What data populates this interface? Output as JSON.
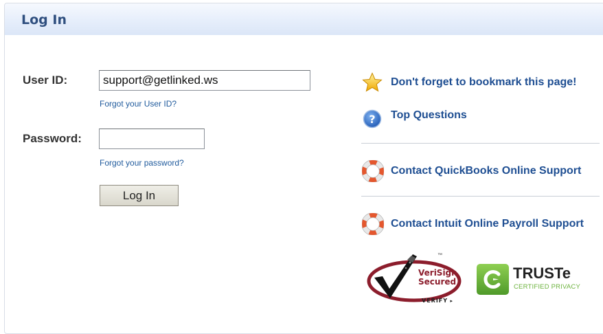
{
  "header": {
    "title": "Log In"
  },
  "form": {
    "user_id_label": "User ID:",
    "user_id_value": "support@getlinked.ws",
    "forgot_user_id": "Forgot your User ID?",
    "password_label": "Password:",
    "password_value": "",
    "forgot_password": "Forgot your password?",
    "login_button": "Log In"
  },
  "sidebar": {
    "bookmark": {
      "label": "Don't forget to bookmark this page!",
      "icon": "star-icon"
    },
    "top_questions": {
      "label": "Top Questions",
      "icon": "question-icon"
    },
    "qbo_support": {
      "label": "Contact QuickBooks Online Support",
      "icon": "lifebuoy-icon"
    },
    "payroll_support": {
      "label": "Contact Intuit Online Payroll Support",
      "icon": "lifebuoy-icon"
    }
  },
  "badges": {
    "verisign": {
      "line1": "VeriSign",
      "line2": "Secured",
      "line3": "VERIFY",
      "tm": "™"
    },
    "truste": {
      "name": "TRUSTe",
      "tagline": "CERTIFIED PRIVACY"
    }
  },
  "colors": {
    "link": "#1e4e92",
    "title": "#2f4f7f",
    "verisign_red": "#8c1d2c",
    "truste_green": "#6db33f"
  }
}
